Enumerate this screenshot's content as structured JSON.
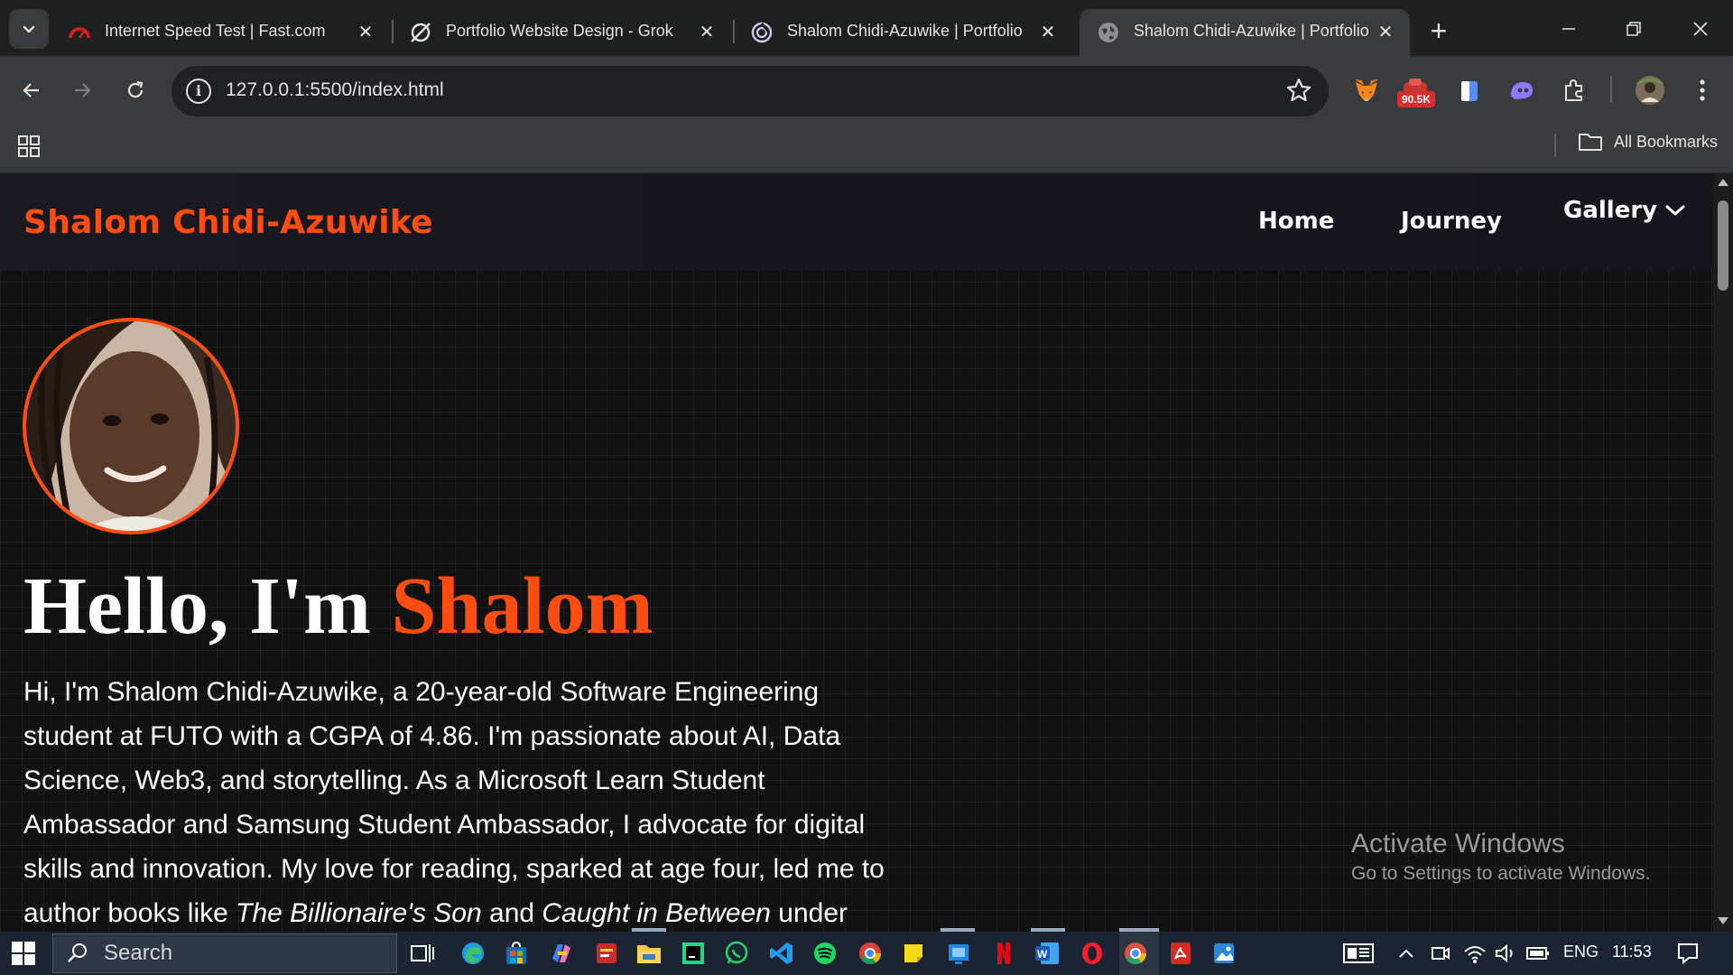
{
  "browser": {
    "tabs": [
      {
        "title": "Internet Speed Test | Fast.com",
        "icon": "fast-com-icon"
      },
      {
        "title": "Portfolio Website Design - Grok",
        "icon": "grok-icon"
      },
      {
        "title": "Shalom Chidi-Azuwike | Portfolio",
        "icon": "live-server-icon"
      },
      {
        "title": "Shalom Chidi-Azuwike | Portfolio",
        "icon": "globe-icon",
        "active": true
      }
    ],
    "url": "127.0.0.1:5500/index.html",
    "extension_badge": "90.5K",
    "bookmarks_label": "All Bookmarks"
  },
  "site": {
    "brand": "Shalom Chidi-Azuwike",
    "nav": {
      "home": "Home",
      "journey": "Journey",
      "gallery": "Gallery"
    },
    "hero": {
      "greeting": "Hello, I'm",
      "name": "Shalom"
    },
    "bio": {
      "part1": "Hi, I'm Shalom Chidi-Azuwike, a 20-year-old Software Engineering student at FUTO with a CGPA of 4.86. I'm passionate about AI, Data Science, Web3, and storytelling. As a Microsoft Learn Student Ambassador and Samsung Student Ambassador, I advocate for digital skills and innovation. My love for reading, sparked at age four, led me to author books like ",
      "book1": "The Billionaire's Son",
      "and": " and ",
      "book2": "Caught in Between",
      "part2": " under"
    },
    "accent_color": "#ff4d12"
  },
  "watermark": {
    "line1": "Activate Windows",
    "line2": "Go to Settings to activate Windows."
  },
  "taskbar": {
    "search_placeholder": "Search",
    "language": "ENG",
    "time": "11:53"
  }
}
